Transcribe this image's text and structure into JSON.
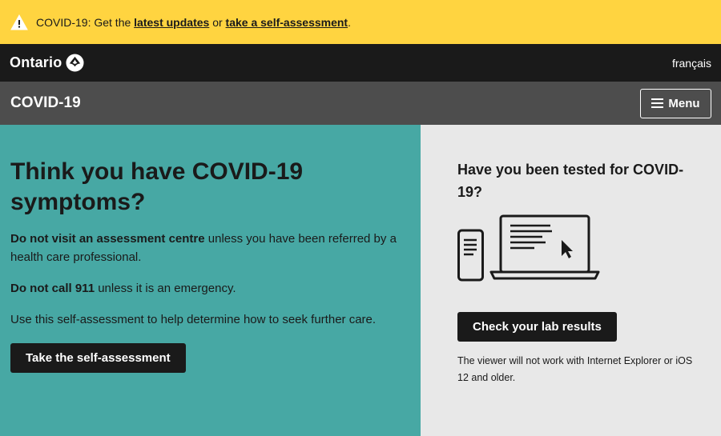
{
  "alert": {
    "prefix": "COVID-19: Get the ",
    "link1": "latest updates",
    "middle": " or ",
    "link2": "take a self-assessment",
    "suffix": ".",
    "icon": "warning-icon"
  },
  "header": {
    "brand": "Ontario",
    "brand_icon": "trillium-icon",
    "language_link": "français"
  },
  "subheader": {
    "title": "COVID-19",
    "menu_label": "Menu",
    "menu_icon": "hamburger-icon"
  },
  "left_panel": {
    "heading": "Think you have COVID-19 symptoms?",
    "p1_bold": "Do not visit an assessment centre",
    "p1_rest": " unless you have been referred by a health care professional.",
    "p2_bold": "Do not call 911",
    "p2_rest": " unless it is an emergency.",
    "p3": "Use this self-assessment to help determine how to seek further care.",
    "button": "Take the self-assessment"
  },
  "right_panel": {
    "heading": "Have you been tested for COVID-19?",
    "illustration": "phone-and-laptop-icon",
    "button": "Check your lab results",
    "note": "The viewer will not work with Internet Explorer or iOS 12 and older."
  },
  "colors": {
    "alert_bg": "#ffd440",
    "topbar_bg": "#1a1a1a",
    "subbar_bg": "#4d4d4d",
    "left_bg": "#47a8a4",
    "right_bg": "#e8e8e8"
  }
}
